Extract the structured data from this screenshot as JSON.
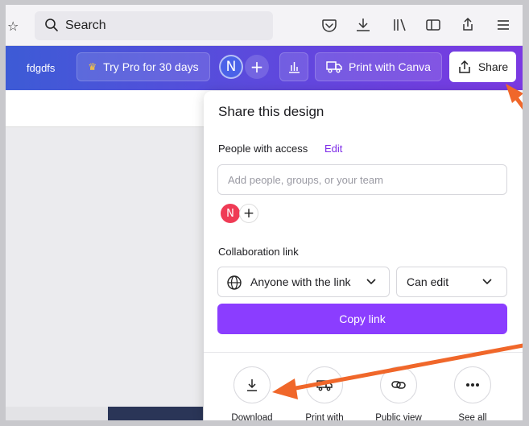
{
  "browser": {
    "search_text": "Search",
    "icons": [
      "star-icon",
      "search-icon",
      "pocket-icon",
      "download-icon",
      "library-icon",
      "sidebar-icon",
      "share-icon",
      "menu-icon"
    ]
  },
  "canva_bar": {
    "doc_name": "fdgdfs",
    "try_pro_label": "Try Pro for 30 days",
    "avatar_initial": "N",
    "add_symbol": "+",
    "print_label": "Print with Canva",
    "share_label": "Share",
    "gradient": [
      "#3d5bd6",
      "#7b3ae2"
    ]
  },
  "share_panel": {
    "title": "Share this design",
    "people_label": "People with access",
    "edit_label": "Edit",
    "add_people_placeholder": "Add people, groups, or your team",
    "member_initial": "N",
    "add_member_symbol": "+",
    "collab_label": "Collaboration link",
    "access_value": "Anyone with the link",
    "permission_value": "Can edit",
    "copy_link_label": "Copy link",
    "accent_color": "#8b3dff",
    "actions": [
      {
        "label": "Download",
        "icon": "download-icon"
      },
      {
        "label": "Print with",
        "icon": "truck-icon"
      },
      {
        "label": "Public view",
        "icon": "link-icon"
      },
      {
        "label": "See all",
        "icon": "more-icon"
      }
    ]
  },
  "annotation_color": "#f0672a"
}
